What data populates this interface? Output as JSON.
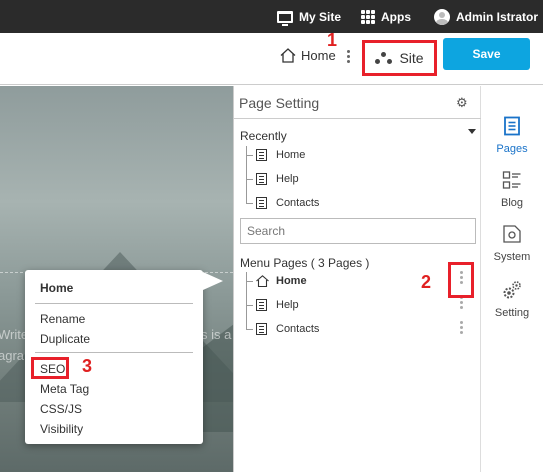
{
  "topbar": {
    "my_site": "My Site",
    "apps": "Apps",
    "user": "Admin Istrator"
  },
  "header": {
    "home_label": "Home",
    "site_label": "Site",
    "save_label": "Save"
  },
  "annotations": [
    "1",
    "2",
    "3"
  ],
  "background": {
    "text_line1": "Write",
    "text_line1_right": "s is a",
    "text_line2": "agra"
  },
  "context_menu": {
    "title": "Home",
    "items_group1": [
      "Rename",
      "Duplicate"
    ],
    "items_group2": [
      "SEO",
      "Meta Tag",
      "CSS/JS",
      "Visibility"
    ]
  },
  "panel": {
    "title": "Page Setting",
    "recently_label": "Recently",
    "recent": [
      "Home",
      "Help",
      "Contacts"
    ],
    "search_placeholder": "Search",
    "menu_pages_label": "Menu Pages ( 3 Pages )",
    "menu_pages": [
      "Home",
      "Help",
      "Contacts"
    ]
  },
  "sidebar": {
    "items": [
      {
        "label": "Pages",
        "icon": "pages-icon"
      },
      {
        "label": "Blog",
        "icon": "blog-icon"
      },
      {
        "label": "System",
        "icon": "system-icon"
      },
      {
        "label": "Setting",
        "icon": "setting-icon"
      }
    ]
  },
  "colors": {
    "accent": "#0da5e0",
    "highlight": "#e8202a",
    "active_sidebar": "#1a73c9",
    "topbar": "#2b2b2b"
  }
}
